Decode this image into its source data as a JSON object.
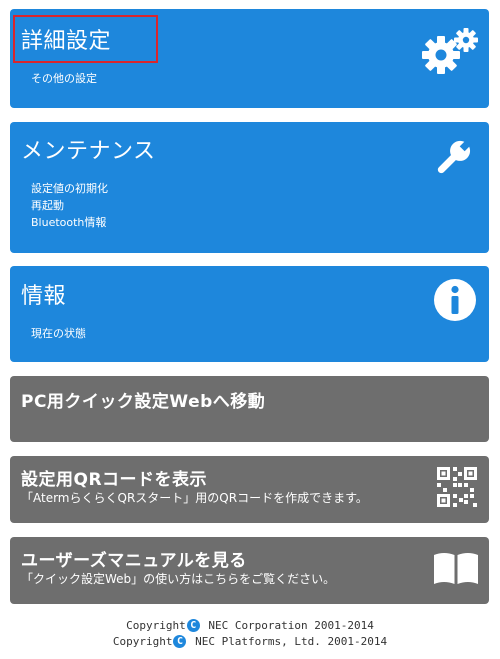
{
  "cards": {
    "advanced": {
      "title": "詳細設定",
      "items": [
        "その他の設定"
      ],
      "icon": "gears-icon"
    },
    "maintenance": {
      "title": "メンテナンス",
      "items": [
        "設定値の初期化",
        "再起動",
        "Bluetooth情報"
      ],
      "icon": "wrench-icon"
    },
    "info": {
      "title": "情報",
      "items": [
        "現在の状態"
      ],
      "icon": "info-icon"
    },
    "pc_quick": {
      "title": "PC用クイック設定Webへ移動"
    },
    "qr": {
      "title": "設定用QRコードを表示",
      "description": "「AtermらくらくQRスタート」用のQRコードを作成できます。",
      "icon": "qr-code-icon"
    },
    "manual": {
      "title": "ユーザーズマニュアルを見る",
      "description": "「クイック設定Web」の使い方はこちらをご覧ください。",
      "icon": "book-icon"
    }
  },
  "footer": {
    "line1_prefix": "Copyright",
    "line1_suffix": " NEC Corporation 2001-2014",
    "line2_prefix": "Copyright",
    "line2_suffix": " NEC Platforms, Ltd. 2001-2014",
    "copyright_symbol": "C"
  },
  "colors": {
    "blue_card": "#1e87dc",
    "gray_card": "#6e6e6e",
    "highlight": "#d9262e"
  }
}
